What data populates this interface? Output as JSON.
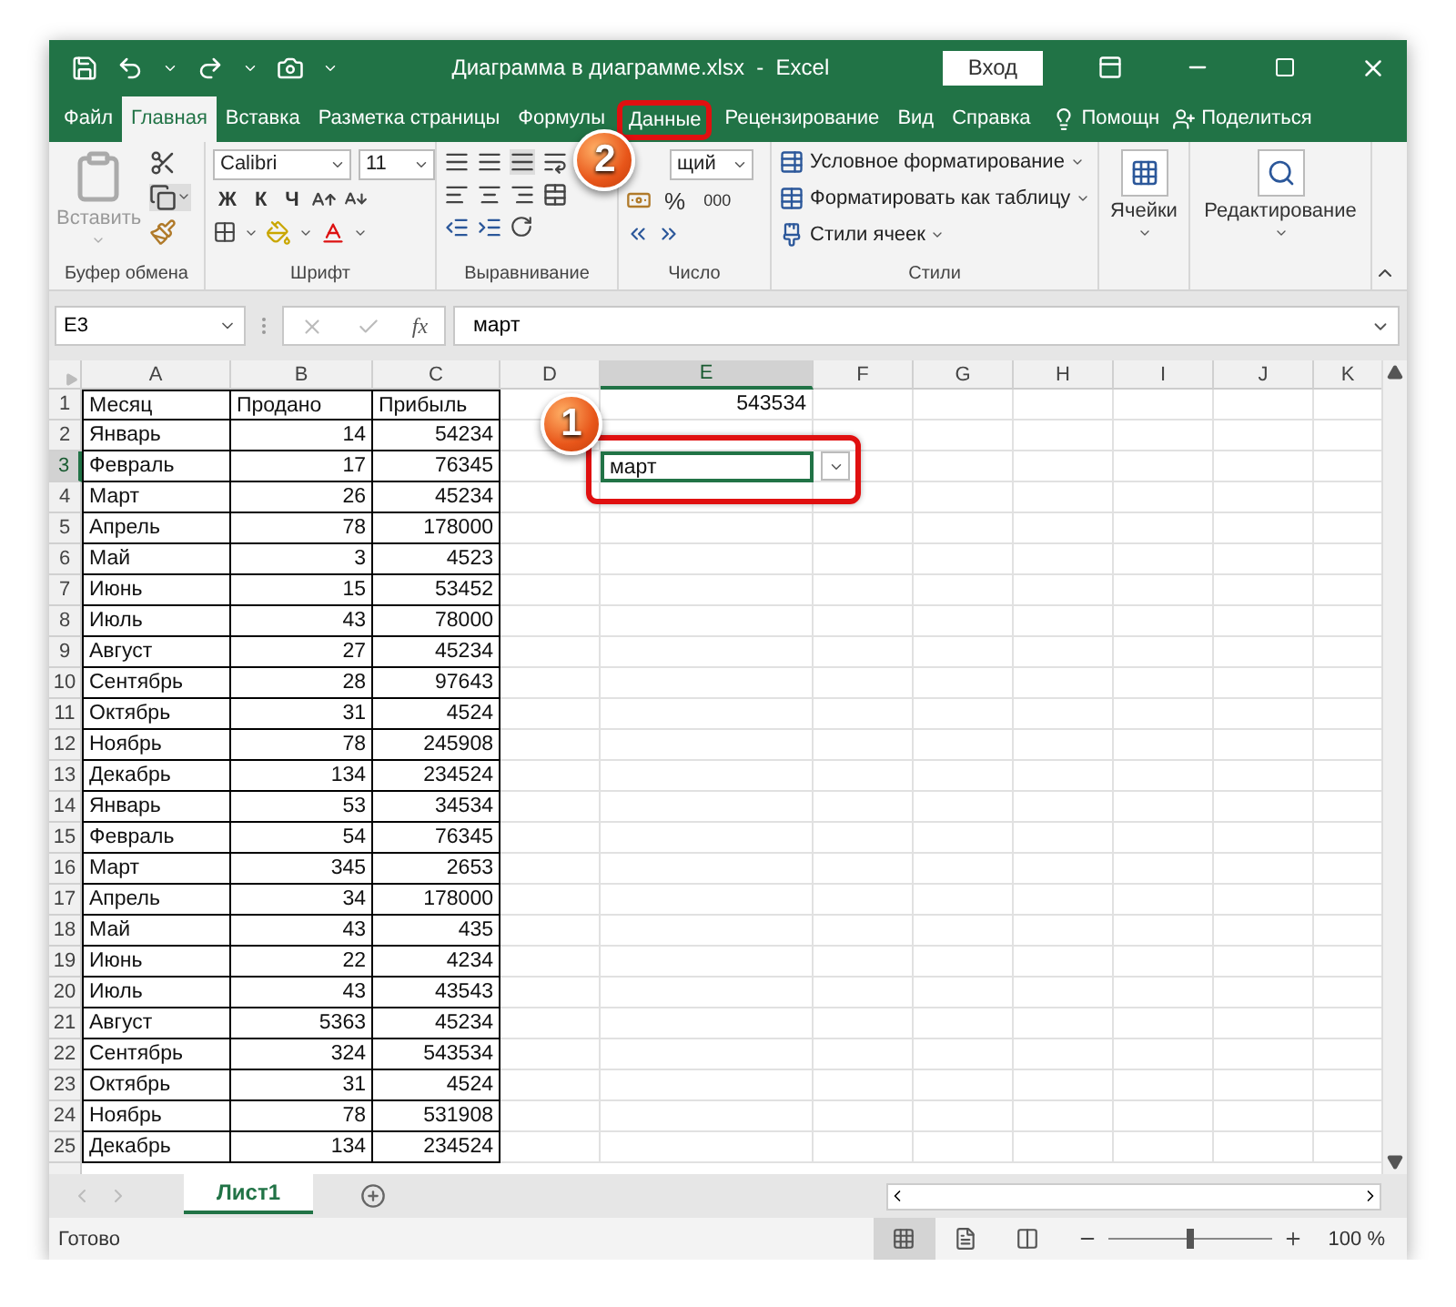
{
  "window": {
    "title": "Диаграмма в диаграмме.xlsx  -  Excel",
    "signin": "Вход"
  },
  "tabs": [
    {
      "label": "Файл",
      "selected": false,
      "highlighted": false
    },
    {
      "label": "Главная",
      "selected": true,
      "highlighted": false
    },
    {
      "label": "Вставка",
      "selected": false,
      "highlighted": false
    },
    {
      "label": "Разметка страницы",
      "selected": false,
      "highlighted": false
    },
    {
      "label": "Формулы",
      "selected": false,
      "highlighted": false
    },
    {
      "label": "Данные",
      "selected": false,
      "highlighted": true,
      "callout": "2"
    },
    {
      "label": "Рецензирование",
      "selected": false,
      "highlighted": false
    },
    {
      "label": "Вид",
      "selected": false,
      "highlighted": false
    },
    {
      "label": "Справка",
      "selected": false,
      "highlighted": false
    }
  ],
  "help": "Помощн",
  "share": "Поделиться",
  "ribbon": {
    "clipboard": {
      "paste": "Вставить",
      "group": "Буфер обмена"
    },
    "font": {
      "name": "Calibri",
      "size": "11",
      "styles": [
        "Ж",
        "К",
        "Ч"
      ],
      "group": "Шрифт"
    },
    "alignment": {
      "group": "Выравнивание"
    },
    "number": {
      "format": "щий",
      "percent": "%",
      "thousands": "000",
      "group": "Число"
    },
    "styles": {
      "items": [
        "Условное форматирование",
        "Форматировать как таблицу",
        "Стили ячеек"
      ],
      "group": "Стили"
    },
    "cells": "Ячейки",
    "editing": "Редактирование"
  },
  "formula_bar": {
    "name_box": "E3",
    "fx": "fx",
    "value": "март"
  },
  "columns": [
    {
      "label": "A",
      "selected": false
    },
    {
      "label": "B",
      "selected": false
    },
    {
      "label": "C",
      "selected": false
    },
    {
      "label": "D",
      "selected": false
    },
    {
      "label": "E",
      "selected": true
    },
    {
      "label": "F",
      "selected": false
    },
    {
      "label": "G",
      "selected": false
    },
    {
      "label": "H",
      "selected": false
    },
    {
      "label": "I",
      "selected": false
    },
    {
      "label": "J",
      "selected": false
    },
    {
      "label": "K",
      "selected": false
    }
  ],
  "rows": [
    {
      "number": "1",
      "selected": false,
      "header": true,
      "a": "Месяц",
      "b": "Продано",
      "c": "Прибыль",
      "e": {
        "text": "543534",
        "kind": "number",
        "active": false,
        "dropdown": false,
        "highlighted": false
      }
    },
    {
      "number": "2",
      "selected": false,
      "a": "Январь",
      "b": "14",
      "c": "54234"
    },
    {
      "number": "3",
      "selected": true,
      "a": "Февраль",
      "b": "17",
      "c": "76345",
      "e": {
        "text": "март",
        "kind": "text",
        "active": true,
        "dropdown": true,
        "highlighted": true,
        "callout": "1"
      }
    },
    {
      "number": "4",
      "selected": false,
      "a": "Март",
      "b": "26",
      "c": "45234"
    },
    {
      "number": "5",
      "selected": false,
      "a": "Апрель",
      "b": "78",
      "c": "178000"
    },
    {
      "number": "6",
      "selected": false,
      "a": "Май",
      "b": "3",
      "c": "4523"
    },
    {
      "number": "7",
      "selected": false,
      "a": "Июнь",
      "b": "15",
      "c": "53452"
    },
    {
      "number": "8",
      "selected": false,
      "a": "Июль",
      "b": "43",
      "c": "78000"
    },
    {
      "number": "9",
      "selected": false,
      "a": "Август",
      "b": "27",
      "c": "45234"
    },
    {
      "number": "10",
      "selected": false,
      "a": "Сентябрь",
      "b": "28",
      "c": "97643"
    },
    {
      "number": "11",
      "selected": false,
      "a": "Октябрь",
      "b": "31",
      "c": "4524"
    },
    {
      "number": "12",
      "selected": false,
      "a": "Ноябрь",
      "b": "78",
      "c": "245908"
    },
    {
      "number": "13",
      "selected": false,
      "a": "Декабрь",
      "b": "134",
      "c": "234524"
    },
    {
      "number": "14",
      "selected": false,
      "a": "Январь",
      "b": "53",
      "c": "34534"
    },
    {
      "number": "15",
      "selected": false,
      "a": "Февраль",
      "b": "54",
      "c": "76345"
    },
    {
      "number": "16",
      "selected": false,
      "a": "Март",
      "b": "345",
      "c": "2653"
    },
    {
      "number": "17",
      "selected": false,
      "a": "Апрель",
      "b": "34",
      "c": "178000"
    },
    {
      "number": "18",
      "selected": false,
      "a": "Май",
      "b": "43",
      "c": "435"
    },
    {
      "number": "19",
      "selected": false,
      "a": "Июнь",
      "b": "22",
      "c": "4234"
    },
    {
      "number": "20",
      "selected": false,
      "a": "Июль",
      "b": "43",
      "c": "43543"
    },
    {
      "number": "21",
      "selected": false,
      "a": "Август",
      "b": "5363",
      "c": "45234"
    },
    {
      "number": "22",
      "selected": false,
      "a": "Сентябрь",
      "b": "324",
      "c": "543534"
    },
    {
      "number": "23",
      "selected": false,
      "a": "Октябрь",
      "b": "31",
      "c": "4524"
    },
    {
      "number": "24",
      "selected": false,
      "a": "Ноябрь",
      "b": "78",
      "c": "531908"
    },
    {
      "number": "25",
      "selected": false,
      "a": "Декабрь",
      "b": "134",
      "c": "234524"
    }
  ],
  "sheets": [
    {
      "label": "Лист1",
      "selected": true
    }
  ],
  "status_bar": {
    "text": "Готово",
    "views": [
      {
        "kind": "normal",
        "selected": true
      },
      {
        "kind": "layout",
        "selected": false
      },
      {
        "kind": "break",
        "selected": false
      }
    ],
    "zoom": {
      "level": 0.5,
      "reading": "100 %"
    }
  }
}
